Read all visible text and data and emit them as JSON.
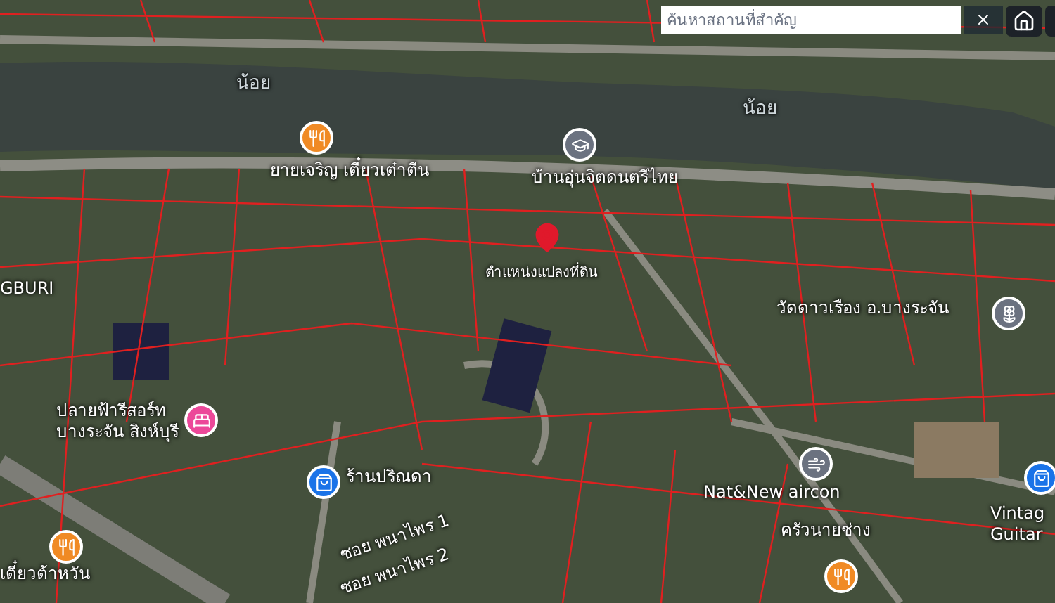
{
  "search": {
    "placeholder": "ค้นหาสถานที่สำคัญ"
  },
  "labels": [
    {
      "kind": "water",
      "text": "น้อย"
    },
    {
      "kind": "water",
      "text": "น้อย"
    },
    {
      "kind": "food",
      "text": "ยายเจริญ เตี๋ยวเต๋าตีน",
      "color": "#f08a24"
    },
    {
      "kind": "school",
      "text": "บ้านอุ่นจิตดนตรีไทย",
      "color": "#6b7280"
    },
    {
      "kind": "marker",
      "text": "ตำแหน่งแปลงที่ดิน",
      "color": "#e0192b"
    },
    {
      "kind": "place",
      "text": "GBURI"
    },
    {
      "kind": "hotel",
      "text": "ปลายฟ้ารีสอร์ท บางระจัน สิงห์บุรี",
      "color": "#ec4899"
    },
    {
      "kind": "temple",
      "text": "วัดดาวเรือง อ.บางระจัน",
      "color": "#6b7280"
    },
    {
      "kind": "aircon",
      "text": "Nat&New aircon",
      "color": "#6b7280"
    },
    {
      "kind": "food",
      "text": "ครัวนายช่าง",
      "color": "#f08a24"
    },
    {
      "kind": "shop",
      "text": "ร้านปริณดา",
      "color": "#1a73e8"
    },
    {
      "kind": "street",
      "text": "ซอย พนาไพร 1"
    },
    {
      "kind": "street",
      "text": "ซอย พนาไพร 2"
    },
    {
      "kind": "food",
      "text": "เตี๋ยวต้าหวัน",
      "color": "#f08a24"
    },
    {
      "kind": "shop",
      "text": "Vintag Guitar",
      "color": "#1a73e8"
    }
  ]
}
